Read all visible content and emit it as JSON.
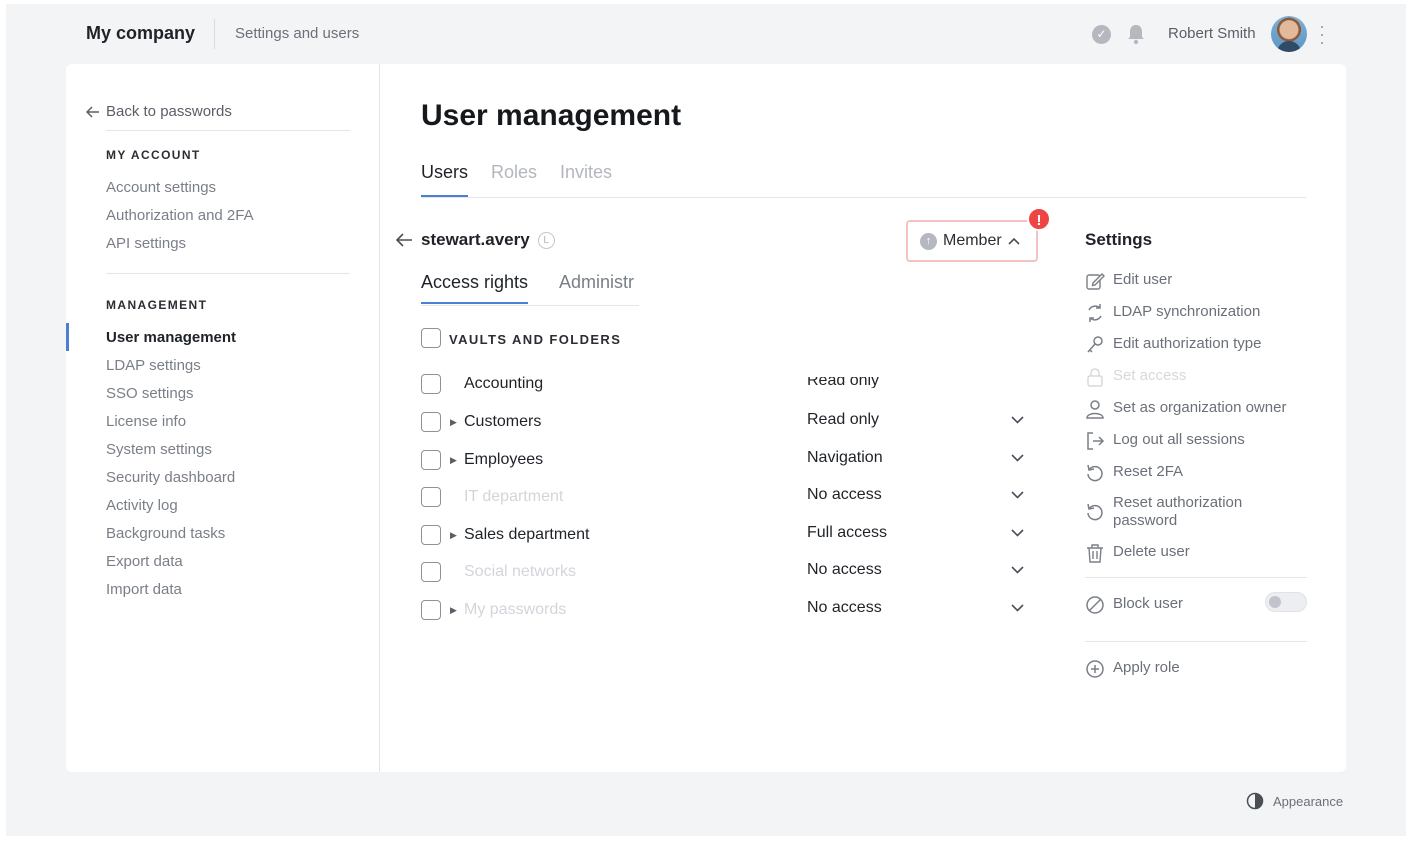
{
  "topbar": {
    "company": "My company",
    "breadcrumb": "Settings and users",
    "user_name": "Robert Smith"
  },
  "sidebar": {
    "back_label": "Back to passwords",
    "my_account_heading": "MY ACCOUNT",
    "my_account_items": [
      "Account settings",
      "Authorization and 2FA",
      "API settings"
    ],
    "management_heading": "MANAGEMENT",
    "management_items": [
      "User management",
      "LDAP settings",
      "SSO settings",
      "License info",
      "System settings",
      "Security dashboard",
      "Activity log",
      "Background tasks",
      "Export data",
      "Import data"
    ]
  },
  "main": {
    "title": "User management",
    "tabs": [
      "Users",
      "Roles",
      "Invites"
    ],
    "active_tab": "Users",
    "user": {
      "name": "stewart.avery",
      "badge": "L",
      "role": "Member",
      "warning": "!"
    },
    "subtabs": [
      "Access rights",
      "Administr"
    ],
    "vaults_heading": "VAULTS AND FOLDERS",
    "rows": [
      {
        "name": "Accounting",
        "access": "Read only"
      },
      {
        "name": "Customers",
        "access": "Read only"
      },
      {
        "name": "Employees",
        "access": "Navigation"
      },
      {
        "name": "IT department",
        "access": "No access"
      },
      {
        "name": "Sales department",
        "access": "Full access"
      },
      {
        "name": "Social networks",
        "access": "No access"
      },
      {
        "name": "My passwords",
        "access": "No access"
      }
    ]
  },
  "settings": {
    "title": "Settings",
    "items": [
      "Edit user",
      "LDAP synchronization",
      "Edit authorization type",
      "Set access",
      "Set as organization owner",
      "Log out all sessions",
      "Reset 2FA",
      "Reset authorization password",
      "Delete user"
    ],
    "block_user": "Block user",
    "block_user_enabled": false,
    "apply_role": "Apply role"
  },
  "footer": {
    "appearance": "Appearance"
  },
  "colors": {
    "accent": "#4a7fd4",
    "warning": "#ef4444",
    "role_border": "#f5c2c2"
  }
}
